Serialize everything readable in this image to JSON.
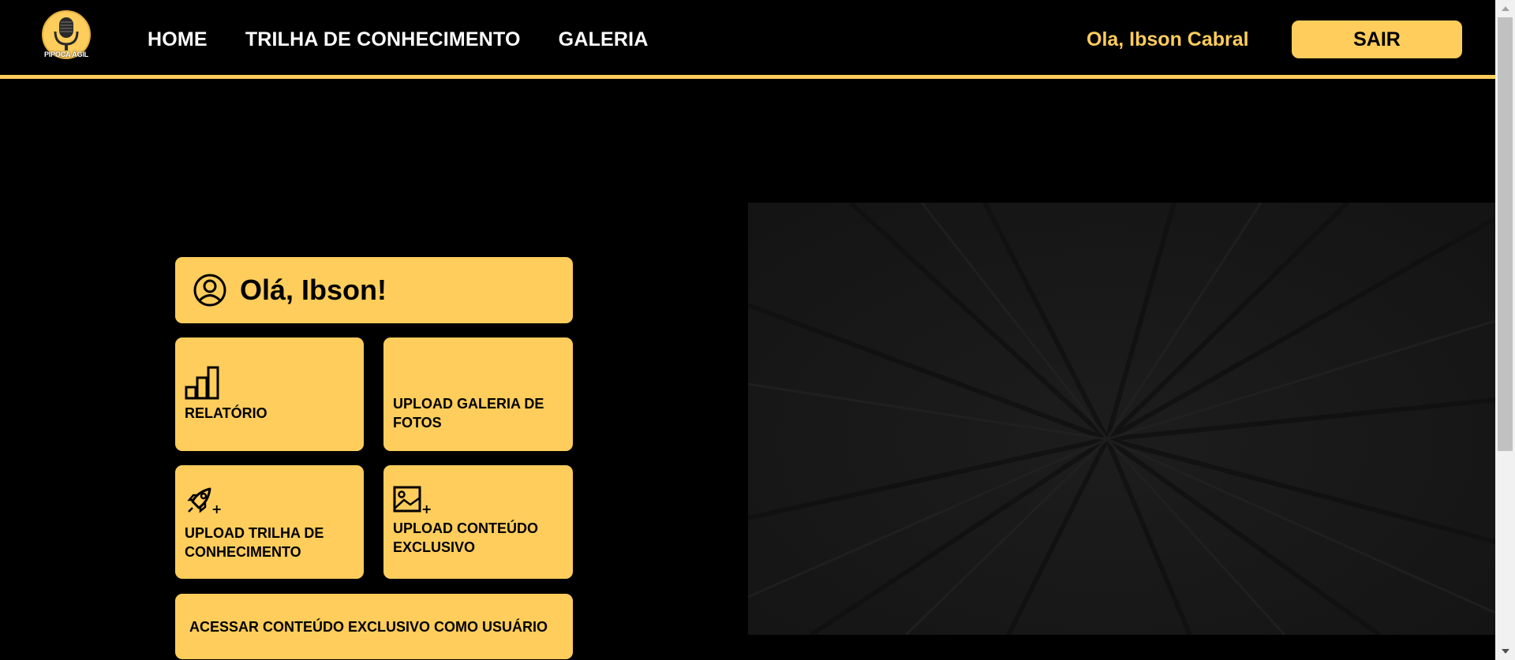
{
  "header": {
    "logo_text": "PIPOCA ÁGIL",
    "nav": [
      "HOME",
      "TRILHA DE CONHECIMENTO",
      "GALERIA"
    ],
    "greeting": "Ola, Ibson Cabral",
    "logout_label": "SAIR"
  },
  "dashboard": {
    "welcome": "Olá, Ibson!",
    "tiles": {
      "report": "RELATÓRIO",
      "upload_gallery": "UPLOAD GALERIA DE FOTOS",
      "upload_trail": "UPLOAD TRILHA DE CONHECIMENTO",
      "upload_exclusive": "UPLOAD CONTEÚDO EXCLUSIVO",
      "access_exclusive": "ACESSAR CONTEÚDO EXCLUSIVO COMO USUÁRIO"
    }
  },
  "colors": {
    "accent": "#ffcd5b",
    "background": "#000000",
    "banner": "#1b1b1b"
  },
  "icons": [
    "microphone-logo-icon",
    "user-circle-icon",
    "bar-chart-icon",
    "rocket-plus-icon",
    "image-plus-icon"
  ]
}
